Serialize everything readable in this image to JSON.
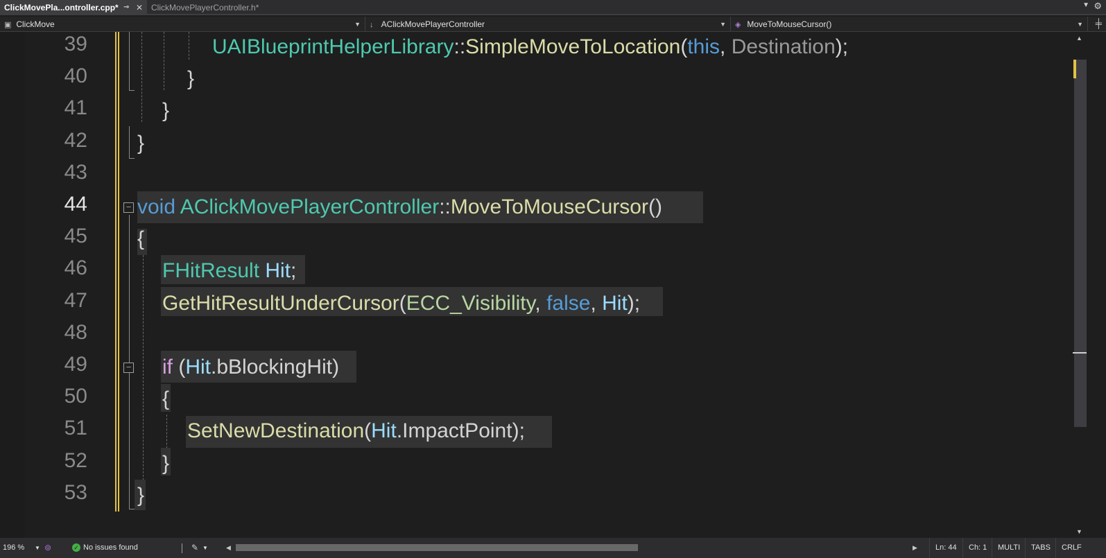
{
  "tabs": [
    {
      "label": "ClickMovePla...ontroller.cpp*",
      "active": true
    },
    {
      "label": "ClickMovePlayerController.h*",
      "active": false
    }
  ],
  "navbar": {
    "project": "ClickMove",
    "class_scope": "AClickMovePlayerController",
    "member": "MoveToMouseCursor()"
  },
  "editor": {
    "current_line": 44,
    "lines": [
      {
        "number": "39",
        "tokens": [
          {
            "t": "UAIBlueprintHelperLibrary",
            "c": "type"
          },
          {
            "t": "::",
            "c": "pn"
          },
          {
            "t": "SimpleMoveToLocation",
            "c": "fn"
          },
          {
            "t": "(",
            "c": "pn"
          },
          {
            "t": "this",
            "c": "kw"
          },
          {
            "t": ", ",
            "c": "pn"
          },
          {
            "t": "Destination",
            "c": "prm"
          },
          {
            "t": ");",
            "c": "pn"
          }
        ]
      },
      {
        "number": "40",
        "tokens": [
          {
            "t": "}",
            "c": "pn"
          }
        ]
      },
      {
        "number": "41",
        "tokens": [
          {
            "t": "}",
            "c": "pn"
          }
        ]
      },
      {
        "number": "42",
        "tokens": [
          {
            "t": "}",
            "c": "pn"
          }
        ]
      },
      {
        "number": "43",
        "tokens": []
      },
      {
        "number": "44",
        "tokens": [
          {
            "t": "void",
            "c": "kw"
          },
          {
            "t": " ",
            "c": "pn"
          },
          {
            "t": "AClickMovePlayerController",
            "c": "type"
          },
          {
            "t": "::",
            "c": "pn"
          },
          {
            "t": "MoveToMouseCursor",
            "c": "fn"
          },
          {
            "t": "()",
            "c": "pn"
          }
        ]
      },
      {
        "number": "45",
        "tokens": [
          {
            "t": "{",
            "c": "pn"
          }
        ]
      },
      {
        "number": "46",
        "tokens": [
          {
            "t": "FHitResult",
            "c": "type"
          },
          {
            "t": " ",
            "c": "pn"
          },
          {
            "t": "Hit",
            "c": "var"
          },
          {
            "t": ";",
            "c": "pn"
          }
        ]
      },
      {
        "number": "47",
        "tokens": [
          {
            "t": "GetHitResultUnderCursor",
            "c": "fn"
          },
          {
            "t": "(",
            "c": "pn"
          },
          {
            "t": "ECC_Visibility",
            "c": "enm"
          },
          {
            "t": ", ",
            "c": "pn"
          },
          {
            "t": "false",
            "c": "kw"
          },
          {
            "t": ", ",
            "c": "pn"
          },
          {
            "t": "Hit",
            "c": "var"
          },
          {
            "t": ");",
            "c": "pn"
          }
        ]
      },
      {
        "number": "48",
        "tokens": []
      },
      {
        "number": "49",
        "tokens": [
          {
            "t": "if",
            "c": "ctl"
          },
          {
            "t": " (",
            "c": "pn"
          },
          {
            "t": "Hit",
            "c": "var"
          },
          {
            "t": ".",
            "c": "pn"
          },
          {
            "t": "bBlockingHit",
            "c": "pn"
          },
          {
            "t": ")",
            "c": "pn"
          }
        ]
      },
      {
        "number": "50",
        "tokens": [
          {
            "t": "{",
            "c": "pn"
          }
        ]
      },
      {
        "number": "51",
        "tokens": [
          {
            "t": "SetNewDestination",
            "c": "fn"
          },
          {
            "t": "(",
            "c": "pn"
          },
          {
            "t": "Hit",
            "c": "var"
          },
          {
            "t": ".",
            "c": "pn"
          },
          {
            "t": "ImpactPoint",
            "c": "pn"
          },
          {
            "t": ");",
            "c": "pn"
          }
        ]
      },
      {
        "number": "52",
        "tokens": [
          {
            "t": "}",
            "c": "pn"
          }
        ]
      },
      {
        "number": "53",
        "tokens": [
          {
            "t": "}",
            "c": "pn"
          }
        ]
      }
    ]
  },
  "statusbar": {
    "zoom": "196 %",
    "issues": "No issues found",
    "line": "Ln: 44",
    "char": "Ch: 1",
    "mode": "MULTI",
    "indent": "TABS",
    "eol": "CRLF"
  },
  "colors": {
    "background": "#1e1e1e",
    "change_marker": "#e2c244",
    "keyword": "#569cd6",
    "type": "#4ec9b0",
    "function": "#dcdcaa",
    "variable": "#9cdcfe",
    "control": "#d8a0df"
  },
  "icons": {
    "tab_pin": "pin-icon",
    "tab_close": "close-icon",
    "fold": "collapse-icon",
    "issues_ok": "check-circle-icon",
    "code_cleanup": "brush-icon",
    "settings": "gear-icon"
  }
}
